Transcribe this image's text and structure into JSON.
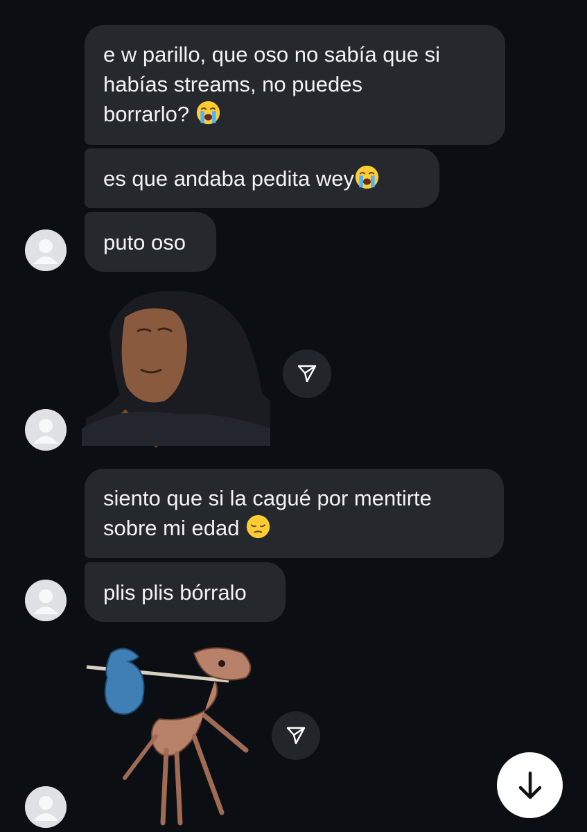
{
  "messages": [
    {
      "text": "e w parillo, que oso no sabía que si\nhabías streams, no puedes\nborrarlo? ",
      "emoji": "loudly-crying-face"
    },
    {
      "text": "es que andaba pedita wey",
      "emoji": "loudly-crying-face"
    },
    {
      "text": "puto oso"
    },
    {
      "text": "siento que si la cagué por mentirte\nsobre mi edad ",
      "emoji": "pensive-face"
    },
    {
      "text": "plis plis bórralo"
    }
  ],
  "stickers": [
    {
      "name": "crying-woman-sticker"
    },
    {
      "name": "ant-with-bindle-sticker"
    }
  ],
  "icons": {
    "share": "paper-plane-icon",
    "scroll_down": "arrow-down-icon",
    "avatar": "default-user-avatar-icon"
  },
  "colors": {
    "background": "#0b0f14",
    "bubble": "#25282d",
    "text": "#f2f3f5"
  }
}
